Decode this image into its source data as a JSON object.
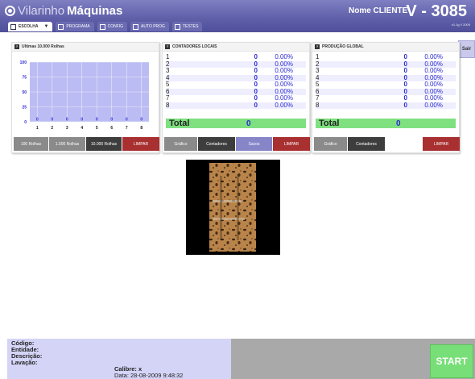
{
  "header": {
    "brand_light": "Vilarinho",
    "brand_bold": "Máquinas",
    "client_name": "Nome CLIENTE",
    "machine_id": "V - 3085",
    "version": "v1.1g // 2009"
  },
  "tabs": [
    {
      "label": "ESCOLHA",
      "caret": "▼"
    },
    {
      "label": "PROGRAMA"
    },
    {
      "label": "CONFIG"
    },
    {
      "label": "AUTO PROG"
    },
    {
      "label": "TESTES"
    }
  ],
  "exit_label": "Sair",
  "panel_rolhas": {
    "icon": "?",
    "title": "Ultimas 10.000 Rolhas",
    "buttons": [
      "100 Rolhas",
      "1.000 Rolhas",
      "10.000 Rolhas",
      "LIMPAR"
    ]
  },
  "chart_data": {
    "type": "bar",
    "categories": [
      "1",
      "2",
      "3",
      "4",
      "5",
      "6",
      "7",
      "8"
    ],
    "values": [
      0,
      0,
      0,
      0,
      0,
      0,
      0,
      0
    ],
    "data_labels": [
      "0",
      "0",
      "0",
      "0",
      "0",
      "0",
      "0",
      "0"
    ],
    "yticks": [
      "100",
      "75",
      "50",
      "25",
      "0"
    ],
    "ylim": [
      0,
      100
    ],
    "grid": true,
    "plot_color": "#bcbcf4"
  },
  "panel_locais": {
    "icon": "?",
    "title": "CONTADORES LOCAIS",
    "rows": [
      {
        "num": "1",
        "val": "0",
        "pct": "0.00%"
      },
      {
        "num": "2",
        "val": "0",
        "pct": "0.00%"
      },
      {
        "num": "3",
        "val": "0",
        "pct": "0.00%"
      },
      {
        "num": "4",
        "val": "0",
        "pct": "0.00%"
      },
      {
        "num": "5",
        "val": "0",
        "pct": "0.00%"
      },
      {
        "num": "6",
        "val": "0",
        "pct": "0.00%"
      },
      {
        "num": "7",
        "val": "0",
        "pct": "0.00%"
      },
      {
        "num": "8",
        "val": "0",
        "pct": "0.00%"
      }
    ],
    "total_label": "Total",
    "total_value": "0",
    "buttons": [
      "Gráfico",
      "Contadores",
      "Sacos",
      "LIMPAR"
    ]
  },
  "panel_global": {
    "icon": "?",
    "title": "PRODUÇÃO GLOBAL",
    "rows": [
      {
        "num": "1",
        "val": "0",
        "pct": "0.00%"
      },
      {
        "num": "2",
        "val": "0",
        "pct": "0.00%"
      },
      {
        "num": "3",
        "val": "0",
        "pct": "0.00%"
      },
      {
        "num": "4",
        "val": "0",
        "pct": "0.00%"
      },
      {
        "num": "5",
        "val": "0",
        "pct": "0.00%"
      },
      {
        "num": "6",
        "val": "0",
        "pct": "0.00%"
      },
      {
        "num": "7",
        "val": "0",
        "pct": "0.00%"
      },
      {
        "num": "8",
        "val": "0",
        "pct": "0.00%"
      }
    ],
    "total_label": "Total",
    "total_value": "0",
    "buttons": [
      "Gráfico",
      "Contadores",
      "LIMPAR"
    ]
  },
  "footer": {
    "codigo": "Código:",
    "entidade": "Entidade:",
    "descricao": "Descrição:",
    "lavacao": "Lavação:",
    "calibre": "Calibre: x",
    "data": "Data: 28-08-2009 9:48:32",
    "start_label": "START"
  },
  "colors": {
    "header": "#5e5ea8",
    "accent_green": "#78df78",
    "value_blue": "#2b2bd0",
    "danger_red": "#a83030"
  }
}
